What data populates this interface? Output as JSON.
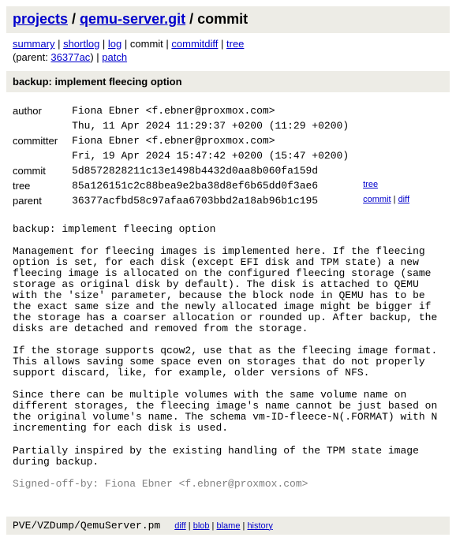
{
  "header": {
    "part1": "projects",
    "sep1": " / ",
    "part2": "qemu-server.git",
    "sep2": " / commit"
  },
  "nav": {
    "summary": "summary",
    "shortlog": "shortlog",
    "log": "log",
    "commit": "commit",
    "commitdiff": "commitdiff",
    "tree": "tree",
    "sep": " | "
  },
  "parent_line": {
    "open": "(parent: ",
    "parent_short": "36377ac",
    "close": ") | ",
    "patch": "patch"
  },
  "title": "backup: implement fleecing option",
  "meta": {
    "author_label": "author",
    "author_value": "Fiona Ebner <f.ebner@proxmox.com>",
    "author_date": "Thu, 11 Apr 2024 11:29:37 +0200 (11:29 +0200)",
    "committer_label": "committer",
    "committer_value": "Fiona Ebner <f.ebner@proxmox.com>",
    "committer_date": "Fri, 19 Apr 2024 15:47:42 +0200 (15:47 +0200)",
    "commit_label": "commit",
    "commit_hash": "5d8572828211c13e1498b4432d0aa8b060fa159d",
    "tree_label": "tree",
    "tree_hash": "85a126151c2c88bea9e2ba38d8ef6b65dd0f3ae6",
    "tree_link": "tree",
    "parent_label": "parent",
    "parent_hash": "36377acfbd58c97afaa6703bbd2a18ab96b1c195",
    "parent_links": {
      "commit": "commit",
      "diff": "diff",
      "sep": " | "
    }
  },
  "message": {
    "p0": "backup: implement fleecing option",
    "p1": "Management for fleecing images is implemented here. If the fleecing option is set, for each disk (except EFI disk and TPM state) a new fleecing image is allocated on the configured fleecing storage (same storage as original disk by default). The disk is attached to QEMU with the 'size' parameter, because the block node in QEMU has to be the exact same size and the newly allocated image might be bigger if the storage has a coarser allocation or rounded up. After backup, the disks are detached and removed from the storage.",
    "p2": "If the storage supports qcow2, use that as the fleecing image format. This allows saving some space even on storages that do not properly support discard, like, for example, older versions of NFS.",
    "p3": "Since there can be multiple volumes with the same volume name on different storages, the fleecing image's name cannot be just based on the original volume's name. The schema vm-ID-fleece-N(.FORMAT) with N incrementing for each disk is used.",
    "p4": "Partially inspired by the existing handling of the TPM state image during backup.",
    "signoff": "Signed-off-by: Fiona Ebner <f.ebner@proxmox.com>"
  },
  "file": {
    "name": "PVE/VZDump/QemuServer.pm",
    "links": {
      "diff": "diff",
      "blob": "blob",
      "blame": "blame",
      "history": "history",
      "sep": " | "
    }
  }
}
